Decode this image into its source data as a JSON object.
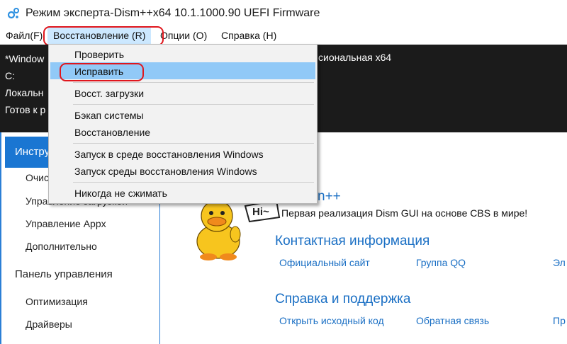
{
  "window": {
    "title": "Режим эксперта-Dism++x64 10.1.1000.90 UEFI Firmware"
  },
  "menubar": [
    {
      "label": "Файл(F)"
    },
    {
      "label": "Восстановление (R)"
    },
    {
      "label": "Опции (O)"
    },
    {
      "label": "Справка (H)"
    }
  ],
  "info": {
    "line1": "*Window",
    "line2": "C:",
    "line3": "Локальн",
    "line4": "Готов к р",
    "os_text": "сиональная x64"
  },
  "dropdown": {
    "items": [
      {
        "label": "Проверить"
      },
      {
        "label": "Исправить"
      },
      {
        "label": "Восст. загрузки"
      },
      {
        "label": "Бэкап системы"
      },
      {
        "label": "Восстановление"
      },
      {
        "label": "Запуск в среде восстановления Windows"
      },
      {
        "label": "Запуск среды восстановления Windows"
      },
      {
        "label": "Никогда не сжимать"
      }
    ]
  },
  "sidebar": {
    "active": "Инстру",
    "items": [
      {
        "label": "Очис"
      },
      {
        "label": "Управление загрузкой"
      },
      {
        "label": "Управление Appx"
      },
      {
        "label": "Дополнительно"
      }
    ],
    "group2": "Панель управления",
    "items2": [
      {
        "label": "Оптимизация"
      },
      {
        "label": "Драйверы"
      }
    ]
  },
  "main": {
    "brand_fragment": "n++",
    "hi_text": "Hi~",
    "tagline": "Первая реализация Dism GUI на основе CBS в мире!",
    "contact_heading": "Контактная информация",
    "contact_links": [
      "Официальный сайт",
      "Группа QQ",
      "Эл"
    ],
    "support_heading": "Справка и поддержка",
    "support_links": [
      "Открыть исходный код",
      "Обратная связь",
      "Пр"
    ]
  },
  "colors": {
    "accent": "#1a76d2",
    "link": "#1a6fc4",
    "highlight": "#91c9f7",
    "annotation": "#e0161d"
  }
}
